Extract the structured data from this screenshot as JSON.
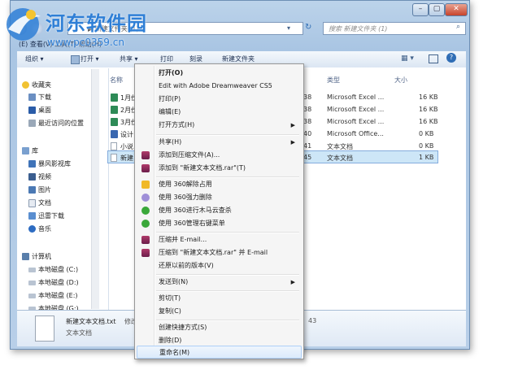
{
  "watermark": {
    "title": "河东软件园",
    "url": "www.pc0359.cn"
  },
  "window": {
    "address_text": "▶ 新建文件夹 (1)",
    "search_placeholder": "搜索 新建文件夹 (1)",
    "top_left_text": "(E) 查看(V) 工具(T) 帮助(H)",
    "buttons": {
      "minimize": "–",
      "maximize": "▢",
      "close": "✕"
    }
  },
  "toolbar": {
    "organize": "组织 ▾",
    "open": "打开 ▾",
    "share": "共享 ▾",
    "print": "打印",
    "burn": "刻录",
    "new_folder": "新建文件夹"
  },
  "nav": {
    "favorites": "收藏夹",
    "downloads": "下载",
    "desktop": "桌面",
    "recent": "最近访问的位置",
    "libraries": "库",
    "storm": "暴风影视库",
    "videos": "视频",
    "pictures": "图片",
    "documents": "文档",
    "xunlei": "迅雷下载",
    "music": "音乐",
    "computer": "计算机",
    "drive_c": "本地磁盘 (C:)",
    "drive_d": "本地磁盘 (D:)",
    "drive_e": "本地磁盘 (E:)",
    "drive_g": "本地磁盘 (G:)"
  },
  "columns": {
    "name": "名称",
    "type": "类型",
    "size": "大小"
  },
  "files": [
    {
      "name": "1月份",
      "time": "38",
      "type": "Microsoft Excel ...",
      "size": "16 KB"
    },
    {
      "name": "2月份",
      "time": "38",
      "type": "Microsoft Excel ...",
      "size": "16 KB"
    },
    {
      "name": "3月份",
      "time": "38",
      "type": "Microsoft Excel ...",
      "size": "16 KB"
    },
    {
      "name": "设计",
      "time": "40",
      "type": "Microsoft Office...",
      "size": "0 KB"
    },
    {
      "name": "小说",
      "time": "41",
      "type": "文本文档",
      "size": "0 KB"
    },
    {
      "name": "新建",
      "time": "45",
      "type": "文本文档",
      "size": "1 KB"
    }
  ],
  "details": {
    "filename": "新建文本文档.txt",
    "modified_label": "修改日",
    "type": "文本文档",
    "size_label": "大",
    "time": "43"
  },
  "menu": {
    "items": [
      {
        "label": "打开(O)",
        "bold": true
      },
      {
        "label": "Edit with Adobe Dreamweaver CS5"
      },
      {
        "label": "打印(P)"
      },
      {
        "label": "编辑(E)"
      },
      {
        "label": "打开方式(H)",
        "submenu": "▶"
      },
      {
        "label": "共享(H)",
        "submenu": "▶"
      },
      {
        "label": "添加到压缩文件(A)..."
      },
      {
        "label": "添加到 \"新建文本文档.rar\"(T)"
      },
      {
        "label": "使用 360解除占用"
      },
      {
        "label": "使用 360强力删除"
      },
      {
        "label": "使用 360进行木马云查杀"
      },
      {
        "label": "使用 360管理右键菜单"
      },
      {
        "label": "压缩并 E-mail..."
      },
      {
        "label": "压缩到 \"新建文本文档.rar\" 并 E-mail"
      },
      {
        "label": "还原以前的版本(V)"
      },
      {
        "label": "发送到(N)",
        "submenu": "▶"
      },
      {
        "label": "剪切(T)"
      },
      {
        "label": "复制(C)"
      },
      {
        "label": "创建快捷方式(S)"
      },
      {
        "label": "删除(D)"
      },
      {
        "label": "重命名(M)"
      }
    ]
  },
  "colors": {
    "accent": "#2f7fd6",
    "selection": "#cde6f7",
    "winrar": "#8b2252",
    "green360": "#3aa83a"
  }
}
